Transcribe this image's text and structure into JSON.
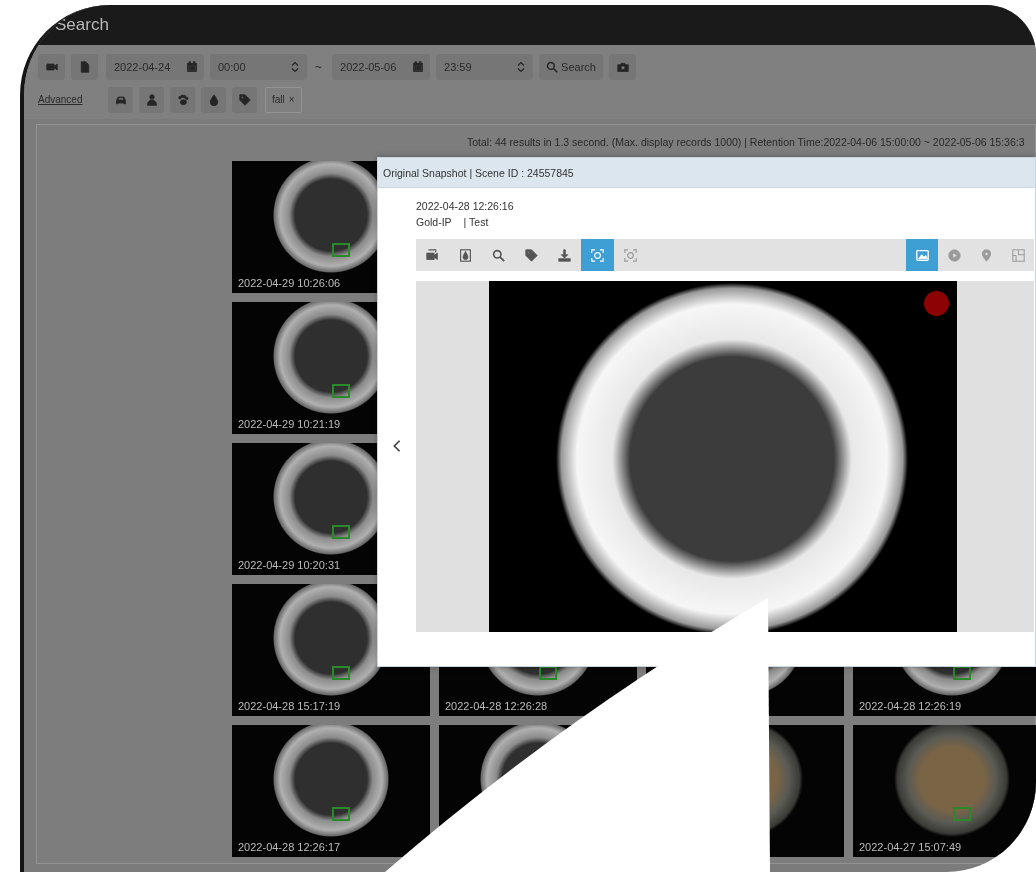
{
  "app_bar": {
    "title": "Search"
  },
  "filters": {
    "start_date": "2022-04-24",
    "start_time": "00:00",
    "separator": "~",
    "end_date": "2022-05-06",
    "end_time": "23:59",
    "search_button": "Search",
    "advanced_link": "Advanced",
    "tags": [
      {
        "label": "fall",
        "remove": "×"
      }
    ]
  },
  "results": {
    "summary": "Total: 44 results in 1.3 second. (Max. display records 1000) | Retention Time:2022-04-06 15:00:00 ~ 2022-05-06 15:36:3",
    "rows": [
      [
        {
          "kind": "mono",
          "timestamp": "2022-04-29 10:26:06"
        }
      ],
      [
        {
          "kind": "mono",
          "timestamp": "2022-04-29 10:21:19"
        }
      ],
      [
        {
          "kind": "mono",
          "timestamp": "2022-04-29 10:20:31"
        }
      ],
      [
        {
          "kind": "mono",
          "timestamp": "2022-04-28 15:17:19"
        },
        {
          "kind": "mono",
          "timestamp": "2022-04-28 12:26:28"
        },
        {
          "kind": "mono"
        },
        {
          "kind": "mono",
          "timestamp": "2022-04-28 12:26:19"
        }
      ],
      [
        {
          "kind": "mono",
          "timestamp": "2022-04-28 12:26:17"
        },
        {
          "kind": "mono"
        },
        {
          "kind": "color"
        },
        {
          "kind": "color",
          "timestamp": "2022-04-27 15:07:49"
        }
      ]
    ]
  },
  "snapshot_dialog": {
    "title": "Original Snapshot | Scene ID : 24557845",
    "time": "2022-04-28 12:26:16",
    "camera": "Gold-IP",
    "group": "| Test",
    "recording": true,
    "tools": [
      {
        "selected": false
      },
      {
        "selected": false
      },
      {
        "selected": false
      },
      {
        "selected": false
      },
      {
        "selected": false
      },
      {
        "selected": true
      },
      {
        "selected": false
      }
    ],
    "view_modes": [
      {
        "selected": true
      },
      {
        "selected": false
      },
      {
        "selected": false
      },
      {
        "selected": false
      }
    ]
  }
}
